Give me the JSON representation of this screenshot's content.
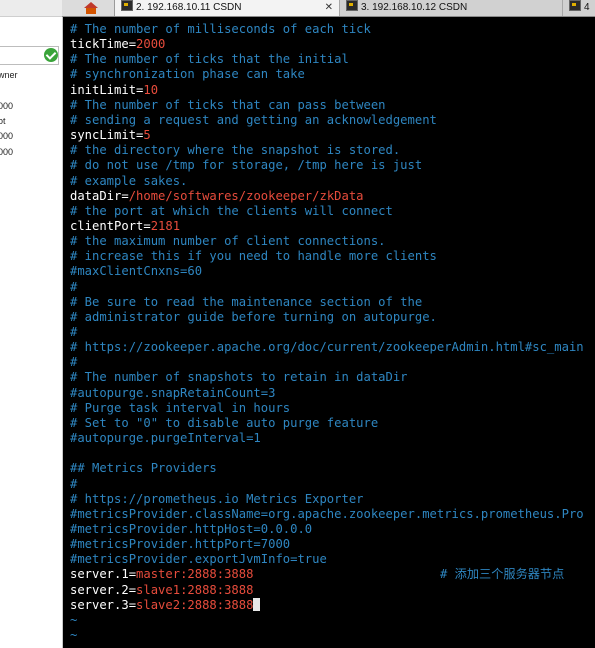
{
  "left_panel": {
    "texts": [
      "wner",
      "000",
      "ot",
      "000",
      "000"
    ]
  },
  "tabs": [
    {
      "label": "2. 192.168.10.11 CSDN",
      "active": true
    },
    {
      "label": "3. 192.168.10.12 CSDN",
      "active": false
    },
    {
      "label": "4",
      "active": false
    }
  ],
  "terminal": {
    "lines": [
      {
        "type": "comment",
        "text": "# The number of milliseconds of each tick"
      },
      {
        "type": "kv",
        "key": "tickTime=",
        "value": "2000"
      },
      {
        "type": "comment",
        "text": "# The number of ticks that the initial"
      },
      {
        "type": "comment",
        "text": "# synchronization phase can take"
      },
      {
        "type": "kv",
        "key": "initLimit=",
        "value": "10"
      },
      {
        "type": "comment",
        "text": "# The number of ticks that can pass between"
      },
      {
        "type": "comment",
        "text": "# sending a request and getting an acknowledgement"
      },
      {
        "type": "kv",
        "key": "syncLimit=",
        "value": "5"
      },
      {
        "type": "comment",
        "text": "# the directory where the snapshot is stored."
      },
      {
        "type": "comment",
        "text": "# do not use /tmp for storage, /tmp here is just"
      },
      {
        "type": "comment",
        "text": "# example sakes."
      },
      {
        "type": "kv",
        "key": "dataDir=",
        "value": "/home/softwares/zookeeper/zkData"
      },
      {
        "type": "comment",
        "text": "# the port at which the clients will connect"
      },
      {
        "type": "kv",
        "key": "clientPort=",
        "value": "2181"
      },
      {
        "type": "comment",
        "text": "# the maximum number of client connections."
      },
      {
        "type": "comment",
        "text": "# increase this if you need to handle more clients"
      },
      {
        "type": "comment",
        "text": "#maxClientCnxns=60"
      },
      {
        "type": "comment",
        "text": "#"
      },
      {
        "type": "comment",
        "text": "# Be sure to read the maintenance section of the"
      },
      {
        "type": "comment",
        "text": "# administrator guide before turning on autopurge."
      },
      {
        "type": "comment",
        "text": "#"
      },
      {
        "type": "comment",
        "text": "# https://zookeeper.apache.org/doc/current/zookeeperAdmin.html#sc_main"
      },
      {
        "type": "comment",
        "text": "#"
      },
      {
        "type": "comment",
        "text": "# The number of snapshots to retain in dataDir"
      },
      {
        "type": "comment",
        "text": "#autopurge.snapRetainCount=3"
      },
      {
        "type": "comment",
        "text": "# Purge task interval in hours"
      },
      {
        "type": "comment",
        "text": "# Set to \"0\" to disable auto purge feature"
      },
      {
        "type": "comment",
        "text": "#autopurge.purgeInterval=1"
      },
      {
        "type": "blank",
        "text": ""
      },
      {
        "type": "comment",
        "text": "## Metrics Providers"
      },
      {
        "type": "comment",
        "text": "#"
      },
      {
        "type": "comment",
        "text": "# https://prometheus.io Metrics Exporter"
      },
      {
        "type": "comment",
        "text": "#metricsProvider.className=org.apache.zookeeper.metrics.prometheus.Pro"
      },
      {
        "type": "comment",
        "text": "#metricsProvider.httpHost=0.0.0.0"
      },
      {
        "type": "comment",
        "text": "#metricsProvider.httpPort=7000"
      },
      {
        "type": "comment",
        "text": "#metricsProvider.exportJvmInfo=true"
      },
      {
        "type": "server",
        "key": "server.1=",
        "value": "master:2888:3888",
        "note": "# 添加三个服务器节点"
      },
      {
        "type": "kv",
        "key": "server.2=",
        "value": "slave1:2888:3888"
      },
      {
        "type": "server_cursor",
        "key": "server.3=",
        "value": "slave2:2888:388",
        "cursor_char": "8"
      },
      {
        "type": "tilde",
        "text": "~"
      },
      {
        "type": "tilde",
        "text": "~"
      }
    ]
  },
  "colors": {
    "comment": "#2e86c1",
    "key": "#ffffff",
    "value": "#e74c3c",
    "background": "#000000"
  }
}
